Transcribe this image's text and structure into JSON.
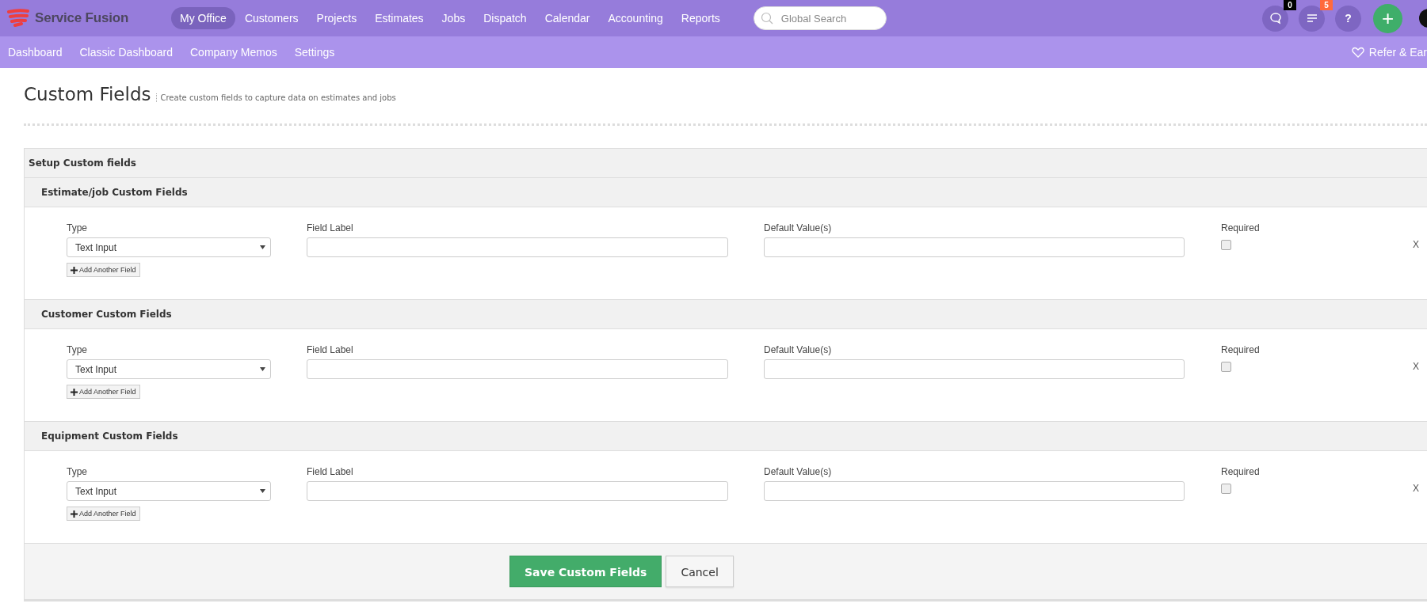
{
  "brand": "Service Fusion",
  "nav": [
    {
      "label": "My Office",
      "selected": true
    },
    {
      "label": "Customers",
      "selected": false
    },
    {
      "label": "Projects",
      "selected": false
    },
    {
      "label": "Estimates",
      "selected": false
    },
    {
      "label": "Jobs",
      "selected": false
    },
    {
      "label": "Dispatch",
      "selected": false
    },
    {
      "label": "Calendar",
      "selected": false
    },
    {
      "label": "Accounting",
      "selected": false
    },
    {
      "label": "Reports",
      "selected": false
    }
  ],
  "search": {
    "placeholder": "Global Search"
  },
  "tools": [
    {
      "kind": "chat",
      "badge": "0",
      "color": "#000000"
    },
    {
      "kind": "list",
      "badge": "5",
      "color": "#ff6a3d"
    },
    {
      "kind": "help",
      "label": "?"
    }
  ],
  "add_button": "+",
  "subnav": [
    "Dashboard",
    "Classic Dashboard",
    "Company Memos",
    "Settings"
  ],
  "refer": "Refer & Ear",
  "page": {
    "title": "Custom Fields",
    "subtitle": "Create custom fields to capture data on estimates and jobs"
  },
  "panel": {
    "title": "Setup Custom fields",
    "sections": [
      {
        "title": "Estimate/job Custom Fields",
        "columns": [
          "Type",
          "Field Label",
          "Default Value(s)",
          "Required"
        ],
        "rows": [
          {
            "type": "Text Input",
            "required": false,
            "remove": "X"
          }
        ],
        "add": "Add Another Field"
      },
      {
        "title": "Customer Custom Fields",
        "columns": [
          "Type",
          "Field Label",
          "Default Value(s)",
          "Required"
        ],
        "rows": [
          {
            "type": "Text Input",
            "required": false,
            "remove": "X"
          }
        ],
        "add": "Add Another Field"
      },
      {
        "title": "Equipment Custom Fields",
        "columns": [
          "Type",
          "Field Label",
          "Default Value(s)",
          "Required"
        ],
        "rows": [
          {
            "type": "Text Input",
            "required": false,
            "remove": "X"
          }
        ],
        "add": "Add Another Field"
      }
    ],
    "buttons": [
      {
        "kind": "primary",
        "label": "Save Custom Fields"
      },
      {
        "kind": "secondary",
        "label": "Cancel"
      }
    ]
  }
}
